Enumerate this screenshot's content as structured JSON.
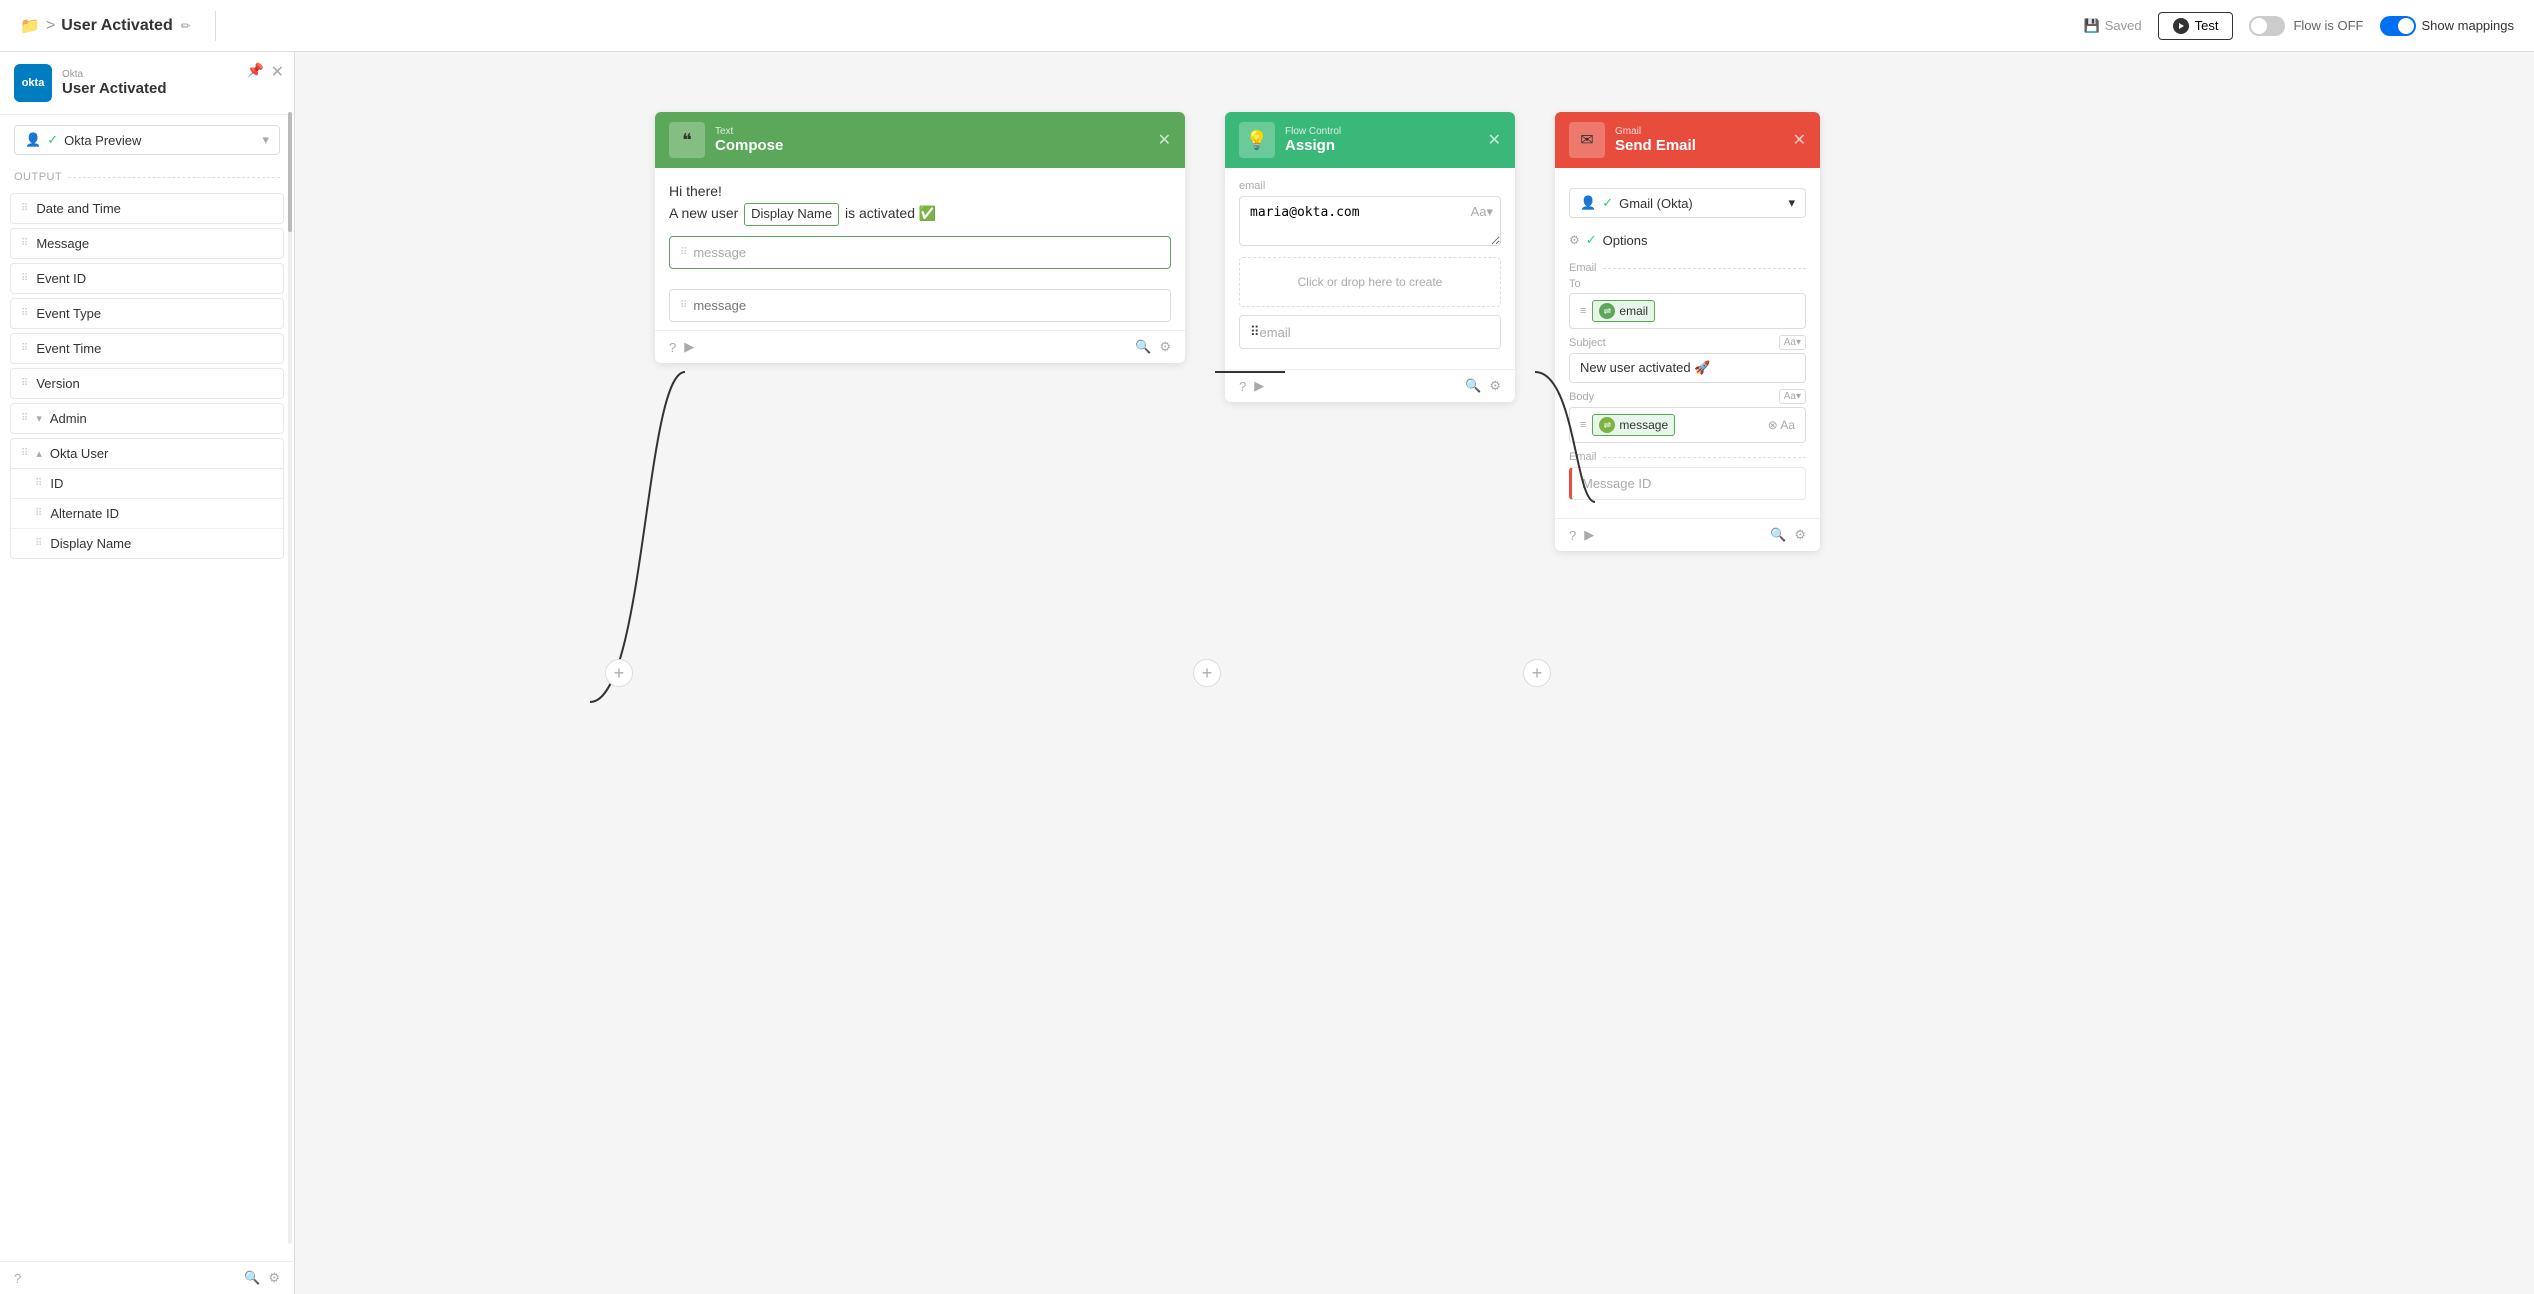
{
  "topbar": {
    "breadcrumb_folder": "📁",
    "breadcrumb_sep": ">",
    "breadcrumb_title": "User Activated",
    "breadcrumb_edit": "✏",
    "saved_label": "Saved",
    "test_label": "Test",
    "flow_status": "Flow is OFF",
    "show_mappings": "Show mappings"
  },
  "sidebar": {
    "brand": "Okta",
    "title": "User Activated",
    "preview_label": "Okta Preview",
    "output_label": "Output",
    "items": [
      {
        "label": "Date and Time"
      },
      {
        "label": "Message"
      },
      {
        "label": "Event ID"
      },
      {
        "label": "Event Type"
      },
      {
        "label": "Event Time"
      },
      {
        "label": "Version"
      },
      {
        "label": "Admin",
        "collapsed": true
      }
    ],
    "okta_user": {
      "label": "Okta User",
      "expanded": true,
      "items": [
        {
          "label": "ID"
        },
        {
          "label": "Alternate ID"
        },
        {
          "label": "Display Name"
        }
      ]
    },
    "footer": {
      "help": "?",
      "search": "🔍",
      "gear": "⚙"
    }
  },
  "compose_card": {
    "brand": "Text",
    "title": "Compose",
    "body_text_1": "Hi there!",
    "body_text_2": "A new user",
    "display_name_pill": "Display Name",
    "body_text_3": "is activated ✅",
    "output_label": "message",
    "input_placeholder": "message"
  },
  "assign_card": {
    "brand": "Flow Control",
    "title": "Assign",
    "field_label": "email",
    "field_value": "maria@okta.com",
    "drop_placeholder": "Click or drop here to create",
    "output_placeholder": "email"
  },
  "gmail_card": {
    "brand": "Gmail",
    "title": "Send Email",
    "account": "Gmail (Okta)",
    "options_label": "Options",
    "email_section_label": "Email",
    "to_label": "To",
    "to_pill_label": "email",
    "subject_label": "Subject",
    "subject_value": "New user activated 🚀",
    "body_label": "Body",
    "body_pill_label": "message",
    "email_section2_label": "Email",
    "message_id_placeholder": "Message ID"
  },
  "plus_buttons": [
    "plus1",
    "plus2",
    "plus3"
  ],
  "connectors": [
    {
      "from": "compose_output",
      "to": "assign_input"
    },
    {
      "from": "assign_output",
      "to": "gmail_body"
    }
  ]
}
